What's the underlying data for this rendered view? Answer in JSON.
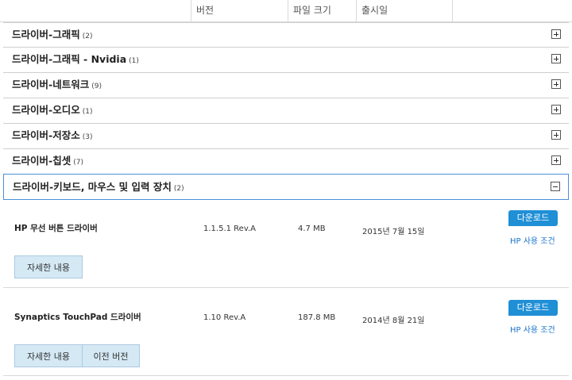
{
  "header": {
    "col_version": "버전",
    "col_size": "파일 크기",
    "col_date": "출시일"
  },
  "categories": [
    {
      "label": "드라이버-그래픽",
      "count": "(2)"
    },
    {
      "label": "드라이버-그래픽 - Nvidia",
      "count": "(1)"
    },
    {
      "label": "드라이버-네트워크",
      "count": "(9)"
    },
    {
      "label": "드라이버-오디오",
      "count": "(1)"
    },
    {
      "label": "드라이버-저장소",
      "count": "(3)"
    },
    {
      "label": "드라이버-칩셋",
      "count": "(7)"
    },
    {
      "label": "드라이버-키보드, 마우스 및 입력 장치",
      "count": "(2)"
    }
  ],
  "drivers": [
    {
      "name": "HP 무선 버튼 드라이버",
      "version": "1.1.5.1 Rev.A",
      "size": "4.7 MB",
      "date": "2015년 7월 15일",
      "download_label": "다운로드",
      "terms_label": "HP 사용 조건",
      "details_label": "자세한 내용"
    },
    {
      "name": "Synaptics TouchPad 드라이버",
      "version": "1.10 Rev.A",
      "size": "187.8 MB",
      "date": "2014년 8월 21일",
      "download_label": "다운로드",
      "terms_label": "HP 사용 조건",
      "details_label": "자세한 내용",
      "previous_label": "이전 버전"
    }
  ],
  "colors": {
    "accent": "#1f8fd6",
    "link": "#1a73c9",
    "secondary_button": "#d5e9f5",
    "expanded_border": "#4a90d9"
  }
}
